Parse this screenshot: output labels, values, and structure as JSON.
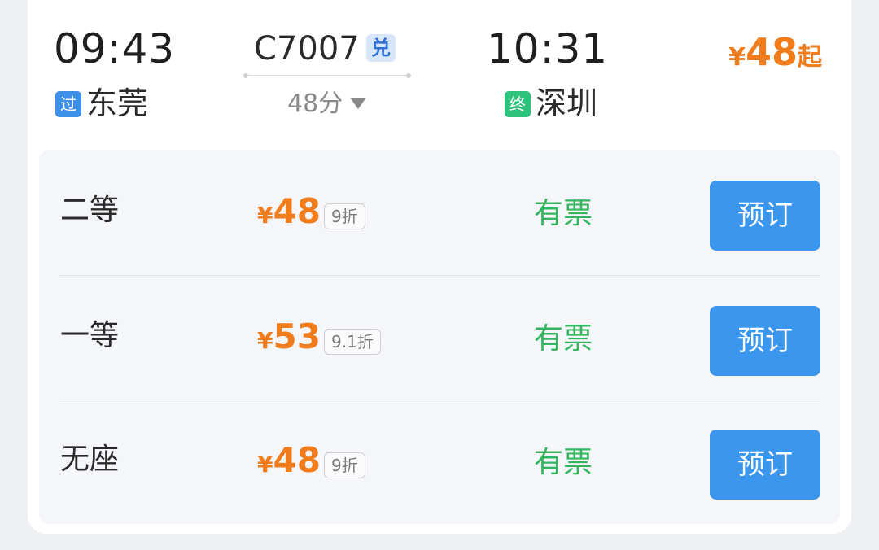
{
  "train": {
    "departure_time": "09:43",
    "departure_station": "东莞",
    "departure_tag": "过",
    "train_number": "C7007",
    "train_badge": "兑",
    "duration": "48分",
    "arrival_time": "10:31",
    "arrival_station": "深圳",
    "arrival_tag": "终",
    "price_currency": "¥",
    "price_amount": "48",
    "price_suffix": "起"
  },
  "seats": [
    {
      "name": "二等",
      "currency": "¥",
      "price": "48",
      "discount": "9折",
      "availability": "有票",
      "book_label": "预订"
    },
    {
      "name": "一等",
      "currency": "¥",
      "price": "53",
      "discount": "9.1折",
      "availability": "有票",
      "book_label": "预订"
    },
    {
      "name": "无座",
      "currency": "¥",
      "price": "48",
      "discount": "9折",
      "availability": "有票",
      "book_label": "预订"
    }
  ],
  "colors": {
    "price": "#f07c1c",
    "available": "#35b560",
    "book_button": "#3b97ee",
    "pass_tag": "#3d8fe8",
    "end_tag": "#2ec27a"
  },
  "icons": {
    "duration_toggle": "triangle-down-icon"
  }
}
